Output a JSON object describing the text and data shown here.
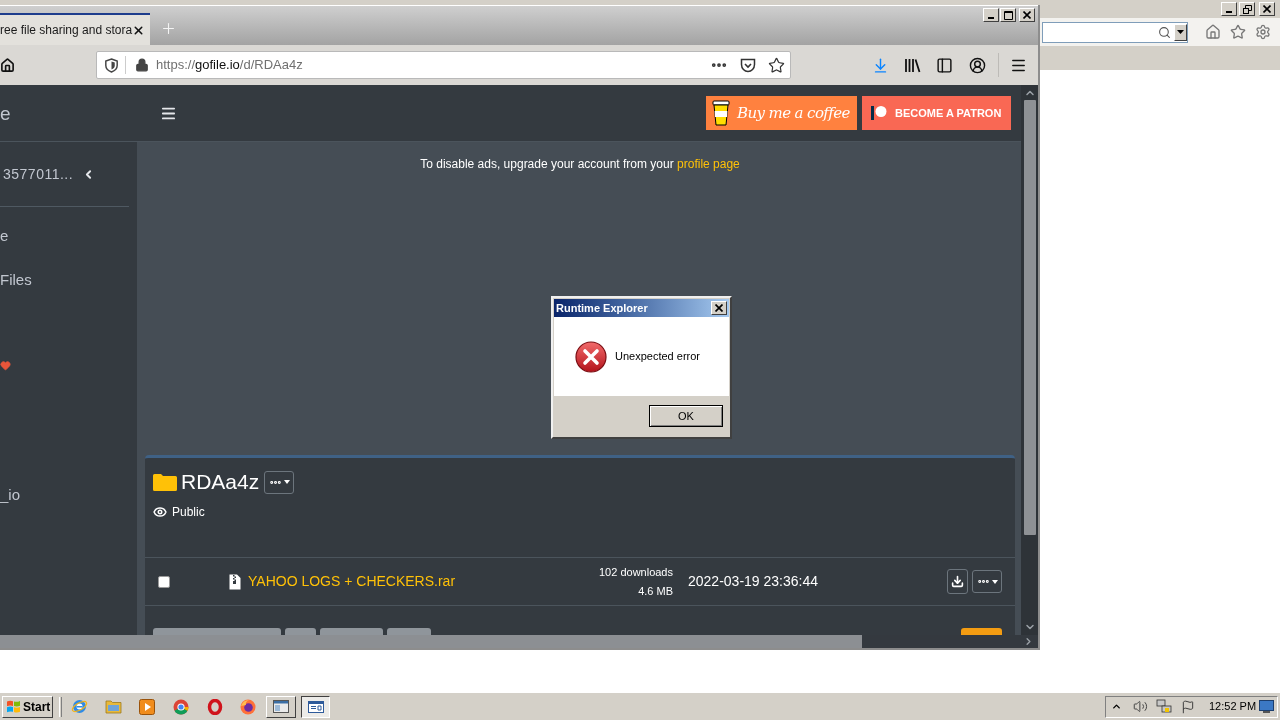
{
  "browser": {
    "tabs": [
      {
        "title": "ree file sharing and stora",
        "selected": true
      }
    ],
    "address": {
      "scheme": "https://",
      "host": "gofile.io",
      "path": "/d/RDAa4z"
    }
  },
  "sidebar": {
    "brand": "e",
    "account": "3577011...",
    "links": [
      {
        "label": "e"
      },
      {
        "label": "Files"
      }
    ],
    "footer": "_io"
  },
  "topbar": {
    "buttons": [
      {
        "kind": "coffee",
        "label": "Buy me a coffee"
      },
      {
        "kind": "patreon",
        "label": "BECOME A PATRON"
      }
    ]
  },
  "notice": {
    "text": "To disable ads, upgrade your account from your",
    "link": "profile page"
  },
  "folder": {
    "name": "RDAa4z",
    "visibility": "Public",
    "files": [
      {
        "name": "YAHOO LOGS + CHECKERS.rar",
        "downloads": "102 downloads",
        "size": "4.6 MB",
        "date": "2022-03-19 23:36:44",
        "checked": false
      }
    ]
  },
  "dialog": {
    "title": "Runtime Explorer",
    "message": "Unexpected error",
    "button": "OK"
  },
  "taskbar": {
    "start": "Start",
    "clock": "12:52 PM"
  }
}
